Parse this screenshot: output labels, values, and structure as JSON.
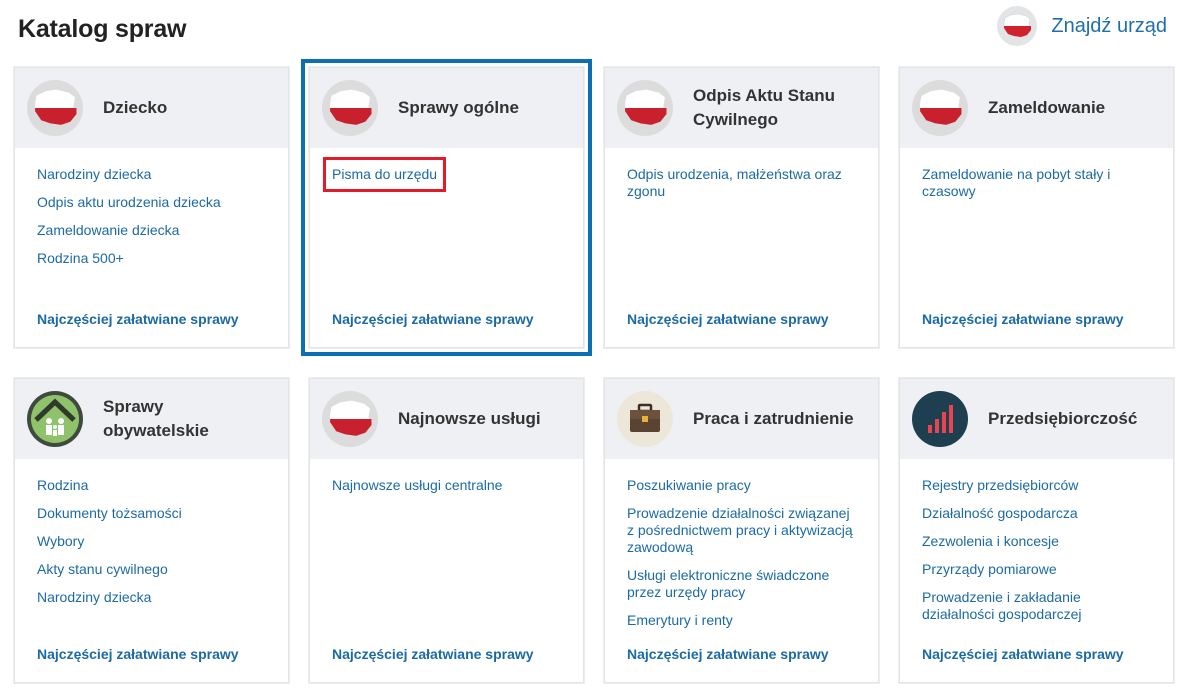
{
  "page_title": "Katalog spraw",
  "find_office": {
    "label": "Znajdź urząd",
    "icon": "poland-map-icon"
  },
  "footer_label": "Najczęściej załatwiane sprawy",
  "colors": {
    "link": "#1b6aa6",
    "selected_border": "#0c6eb3",
    "highlight_border": "#e21b2b",
    "header_bg": "#eef0f3"
  },
  "cards": [
    {
      "title": "Dziecko",
      "icon": "poland-map-icon",
      "links": [
        "Narodziny dziecka",
        "Odpis aktu urodzenia dziecka",
        "Zameldowanie dziecka",
        "Rodzina 500+"
      ],
      "footer": "Najczęściej załatwiane sprawy"
    },
    {
      "title": "Sprawy ogólne",
      "icon": "poland-map-icon",
      "links": [
        "Pisma do urzędu"
      ],
      "footer": "Najczęściej załatwiane sprawy"
    },
    {
      "title": "Odpis Aktu Stanu Cywilnego",
      "icon": "poland-map-icon",
      "links": [
        "Odpis urodzenia, małżeństwa oraz zgonu"
      ],
      "footer": "Najczęściej załatwiane sprawy"
    },
    {
      "title": "Zameldowanie",
      "icon": "poland-map-icon",
      "links": [
        "Zameldowanie na pobyt stały i czasowy"
      ],
      "footer": "Najczęściej załatwiane sprawy"
    },
    {
      "title": "Sprawy obywatelskie",
      "icon": "family-house-icon",
      "links": [
        "Rodzina",
        "Dokumenty tożsamości",
        "Wybory",
        "Akty stanu cywilnego",
        "Narodziny dziecka"
      ],
      "footer": "Najczęściej załatwiane sprawy"
    },
    {
      "title": "Najnowsze usługi",
      "icon": "poland-map-icon",
      "links": [
        "Najnowsze usługi centralne"
      ],
      "footer": "Najczęściej załatwiane sprawy"
    },
    {
      "title": "Praca i zatrudnienie",
      "icon": "briefcase-icon",
      "links": [
        "Poszukiwanie pracy",
        "Prowadzenie działalności związanej z pośrednictwem pracy i aktywizacją zawodową",
        "Usługi elektroniczne świadczone przez urzędy pracy",
        "Emerytury i renty"
      ],
      "footer": "Najczęściej załatwiane sprawy"
    },
    {
      "title": "Przedsiębiorczość",
      "icon": "bar-chart-icon",
      "links": [
        "Rejestry przedsiębiorców",
        "Działalność gospodarcza",
        "Zezwolenia i koncesje",
        "Przyrządy pomiarowe",
        "Prowadzenie i zakładanie działalności gospodarczej"
      ],
      "footer": "Najczęściej załatwiane sprawy"
    }
  ]
}
